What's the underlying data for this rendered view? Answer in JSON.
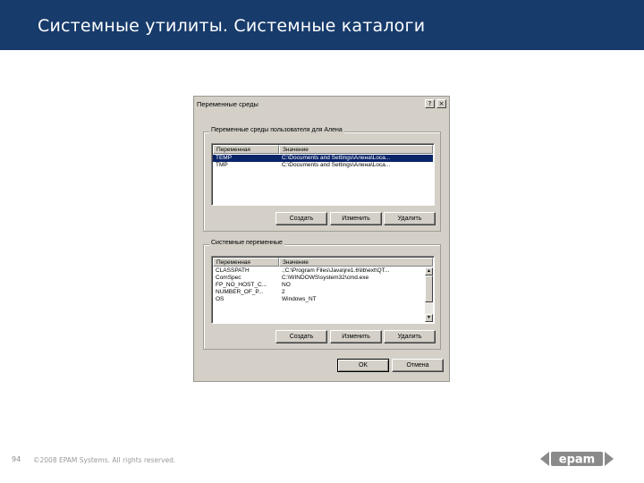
{
  "slide": {
    "title": "Системные утилиты. Системные каталоги",
    "page_number": "94",
    "copyright": "©2008 EPAM Systems. All rights reserved.",
    "logo_text": "epam",
    "header_color": "#173b6b"
  },
  "dialog": {
    "title": "Переменные среды",
    "help_glyph": "?",
    "close_glyph": "×",
    "user_group": {
      "legend": "Переменные среды пользователя для Алена",
      "columns": [
        "Переменная",
        "Значение"
      ],
      "rows": [
        {
          "name": "TEMP",
          "value": "C:\\Documents and Settings\\Алена\\Loca...",
          "selected": true
        },
        {
          "name": "TMP",
          "value": "C:\\Documents and Settings\\Алена\\Loca...",
          "selected": false
        }
      ],
      "buttons": [
        "Создать",
        "Изменить",
        "Удалить"
      ]
    },
    "system_group": {
      "legend": "Системные переменные",
      "columns": [
        "Переменная",
        "Значение"
      ],
      "rows": [
        {
          "name": "CLASSPATH",
          "value": ".;C:\\Program Files\\Java\\jre1.6\\lib\\ext\\QT...",
          "selected": false
        },
        {
          "name": "ComSpec",
          "value": "C:\\WINDOWS\\system32\\cmd.exe",
          "selected": false
        },
        {
          "name": "FP_NO_HOST_C...",
          "value": "NO",
          "selected": false
        },
        {
          "name": "NUMBER_OF_P...",
          "value": "2",
          "selected": false
        },
        {
          "name": "OS",
          "value": "Windows_NT",
          "selected": false
        }
      ],
      "buttons": [
        "Создать",
        "Изменить",
        "Удалить"
      ]
    },
    "ok_label": "OK",
    "cancel_label": "Отмена",
    "selection_color": "#0a246a",
    "face_color": "#d4d0c8"
  }
}
